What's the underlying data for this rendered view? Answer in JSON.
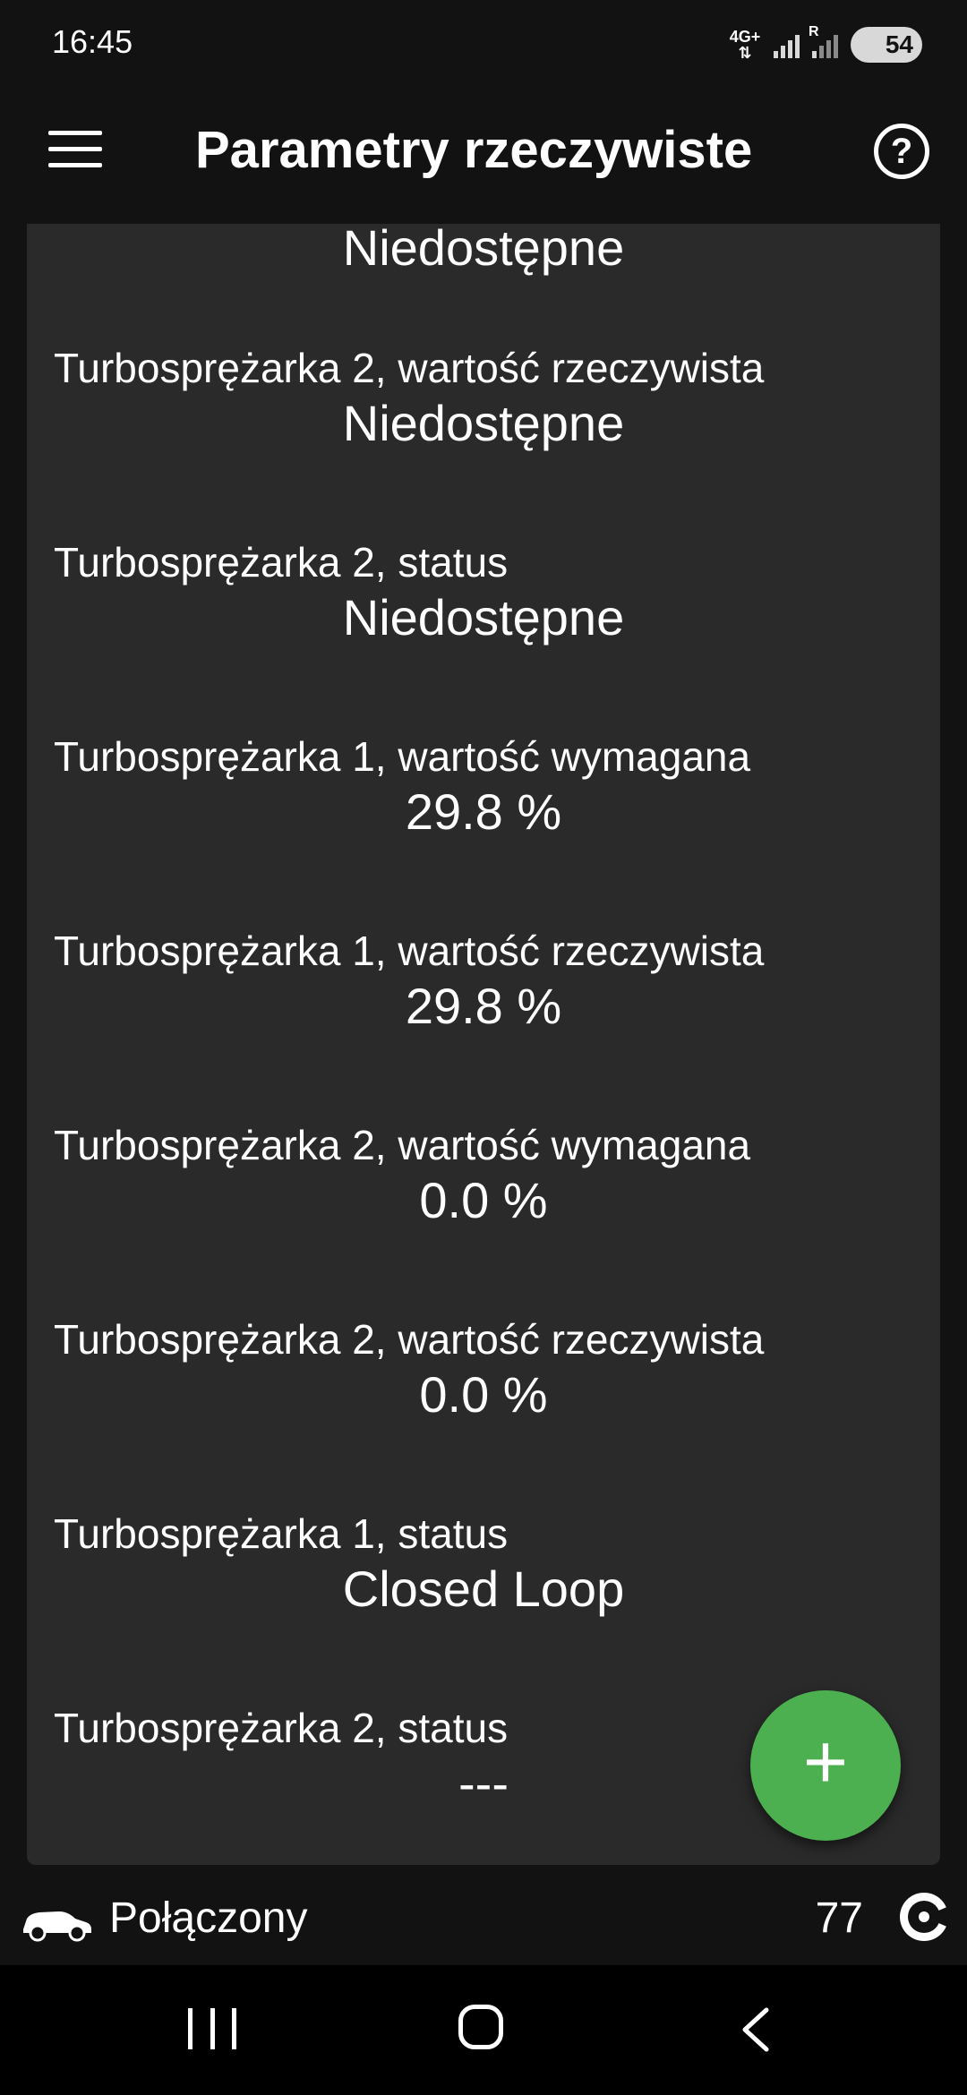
{
  "status_bar": {
    "time": "16:45",
    "network": "4G+",
    "roaming": "R",
    "battery": "54"
  },
  "app_bar": {
    "title": "Parametry rzeczywiste",
    "menu_icon": "hamburger-menu-icon",
    "help_icon": "help-circle-icon",
    "help_symbol": "?"
  },
  "params": [
    {
      "label": "",
      "value": "Niedostępne"
    },
    {
      "label": "Turbosprężarka 2, wartość rzeczywista",
      "value": "Niedostępne"
    },
    {
      "label": "Turbosprężarka 2, status",
      "value": "Niedostępne"
    },
    {
      "label": "Turbosprężarka 1, wartość wymagana",
      "value": "29.8 %"
    },
    {
      "label": "Turbosprężarka 1, wartość rzeczywista",
      "value": "29.8 %"
    },
    {
      "label": "Turbosprężarka 2, wartość wymagana",
      "value": "0.0 %"
    },
    {
      "label": "Turbosprężarka 2, wartość rzeczywista",
      "value": "0.0 %"
    },
    {
      "label": "Turbosprężarka 1, status",
      "value": "Closed Loop"
    },
    {
      "label": "Turbosprężarka 2, status",
      "value": "---"
    }
  ],
  "fab": {
    "symbol": "+",
    "icon": "plus-icon",
    "color": "#4caf50"
  },
  "bottom_status": {
    "connection": "Połączony",
    "counter": "77",
    "car_icon": "car-icon",
    "gauge_icon": "gauge-icon"
  },
  "colors": {
    "background": "#121212",
    "card": "#2a2a2a",
    "text": "#ffffff",
    "accent": "#4caf50"
  }
}
